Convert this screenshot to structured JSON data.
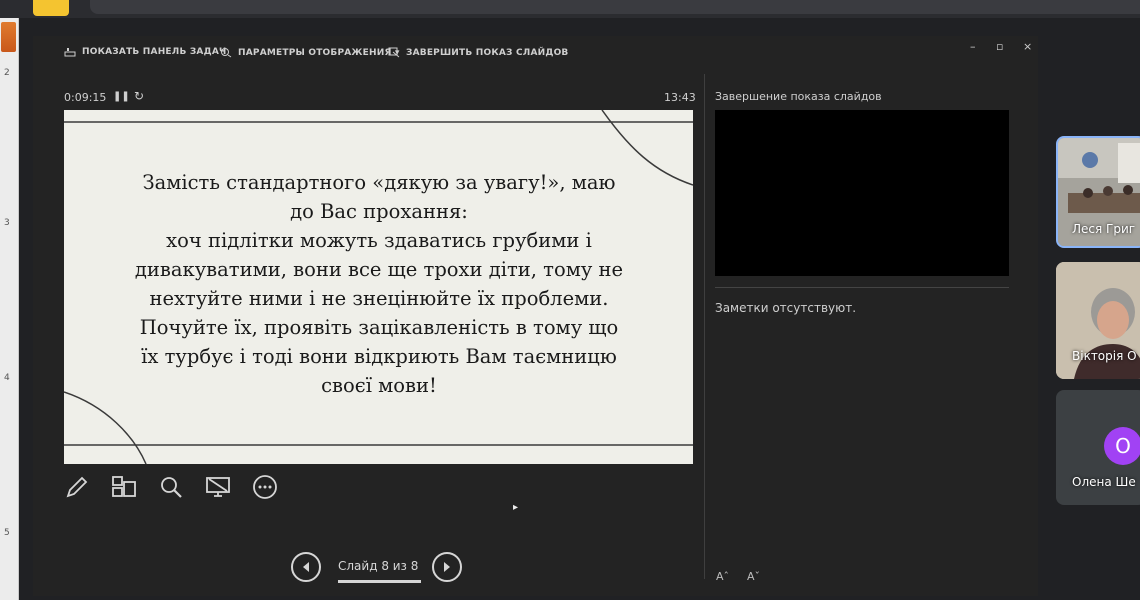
{
  "toolbar": {
    "show_taskbar": "ПОКАЗАТЬ ПАНЕЛЬ ЗАДАЧ",
    "display_settings": "ПАРАМЕТРЫ ОТОБРАЖЕНИЯ ▾",
    "end_show": "ЗАВЕРШИТЬ ПОКАЗ СЛАЙДОВ"
  },
  "window": {
    "minimize": "–",
    "restore": "▫",
    "close": "×"
  },
  "timer": {
    "elapsed": "0:09:15",
    "clock": "13:43"
  },
  "slide": {
    "lines": [
      "Замість стандартного «дякую за увагу!», маю",
      "до Вас прохання:",
      "хоч підлітки можуть здаватись грубими і",
      "дивакуватими, вони все ще трохи діти, тому не",
      "нехтуйте ними і не знецінюйте їх проблеми.",
      "Почуйте їх, проявіть зацікавленість в тому що",
      "їх турбує і тоді вони відкриють Вам таємницю",
      "своєї мови!"
    ]
  },
  "navigation": {
    "counter": "Слайд 8 из 8"
  },
  "side": {
    "next_label": "Завершение показа слайдов",
    "notes": "Заметки отсутствуют.",
    "font_increase": "Aˆ",
    "font_decrease": "Aˇ"
  },
  "participants": [
    {
      "name": "Леся Григ"
    },
    {
      "name": "Вікторія О"
    },
    {
      "name": "Олена Ше",
      "initial": "О",
      "color": "#a142f4"
    }
  ],
  "ruler": {
    "marks": [
      "2",
      "3",
      "4",
      "5"
    ]
  },
  "colors": {
    "accent_border": "#8ab4f8",
    "app_icon": "#f4c430"
  }
}
